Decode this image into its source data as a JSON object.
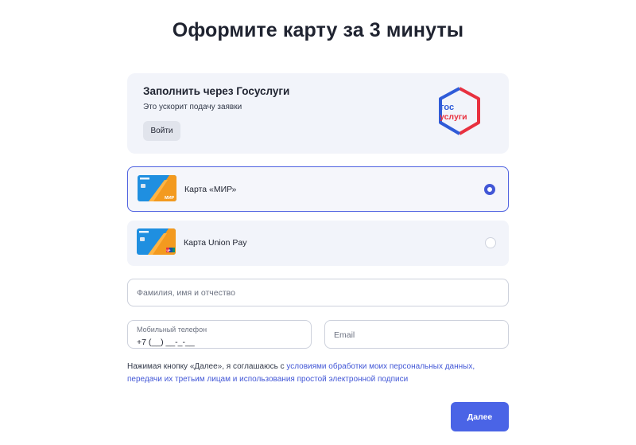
{
  "page": {
    "title": "Оформите карту за 3 минуты"
  },
  "gosuslugi": {
    "title": "Заполнить через Госуслуги",
    "subtitle": "Это ускорит подачу заявки",
    "login_label": "Войти",
    "logo_line1": "гос",
    "logo_line2": "услуги"
  },
  "card_options": [
    {
      "label": "Карта «МИР»",
      "selected": true,
      "badge": "МИР"
    },
    {
      "label": "Карта Union Pay",
      "selected": false,
      "badge": "UP"
    }
  ],
  "form": {
    "fio_placeholder": "Фамилия, имя и отчество",
    "phone_label": "Мобильный телефон",
    "phone_value": "+7 (__) __-_-__",
    "email_placeholder": "Email"
  },
  "consent": {
    "text_before": "Нажимая кнопку «Далее», я соглашаюсь с ",
    "link1": "условиями обработки моих персональных данных,",
    "link2": "передачи их третьим лицам и использования простой электронной подписи"
  },
  "actions": {
    "next_label": "Далее"
  },
  "colors": {
    "accent": "#4a64e6",
    "panel_bg": "#f2f4fa",
    "link": "#4257d6",
    "gos_blue": "#2f5bd8",
    "gos_red": "#e8313f"
  }
}
